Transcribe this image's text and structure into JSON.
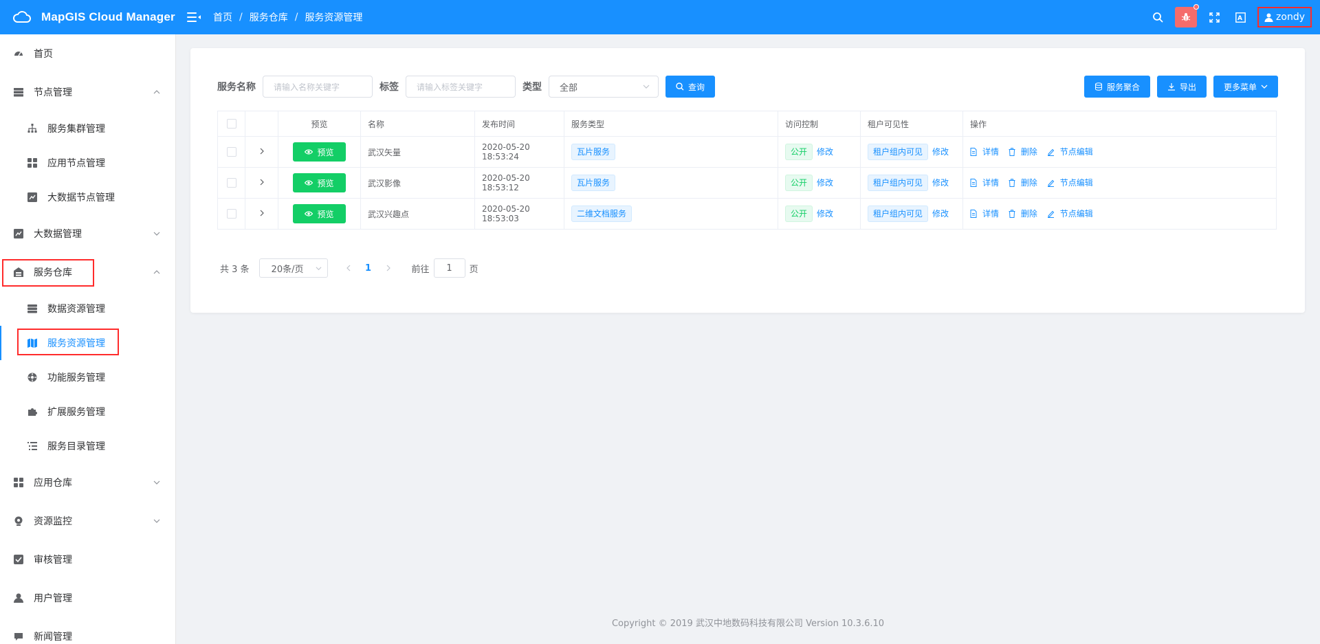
{
  "app": {
    "title": "MapGIS Cloud Manager"
  },
  "breadcrumb": [
    "首页",
    "服务仓库",
    "服务资源管理"
  ],
  "user": {
    "name": "zondy"
  },
  "colors": {
    "primary": "#1890ff",
    "success": "#13ce66",
    "danger": "#f56c6c",
    "highlight": "#ff2b2b"
  },
  "sidebar": {
    "items": [
      {
        "label": "首页",
        "icon": "dashboard-icon"
      },
      {
        "label": "节点管理",
        "icon": "server-icon",
        "expanded": true
      },
      {
        "label": "服务集群管理",
        "icon": "cluster-icon"
      },
      {
        "label": "应用节点管理",
        "icon": "grid-icon"
      },
      {
        "label": "大数据节点管理",
        "icon": "chart-icon"
      },
      {
        "label": "大数据管理",
        "icon": "chart-icon",
        "expanded": false
      },
      {
        "label": "服务仓库",
        "icon": "warehouse-icon",
        "expanded": true
      },
      {
        "label": "数据资源管理",
        "icon": "database-icon"
      },
      {
        "label": "服务资源管理",
        "icon": "map-icon",
        "active": true
      },
      {
        "label": "功能服务管理",
        "icon": "function-icon"
      },
      {
        "label": "扩展服务管理",
        "icon": "puzzle-icon"
      },
      {
        "label": "服务目录管理",
        "icon": "list-icon"
      },
      {
        "label": "应用仓库",
        "icon": "grid-icon",
        "expanded": false
      },
      {
        "label": "资源监控",
        "icon": "monitor-icon",
        "expanded": false
      },
      {
        "label": "审核管理",
        "icon": "check-icon"
      },
      {
        "label": "用户管理",
        "icon": "user-icon"
      },
      {
        "label": "新闻管理",
        "icon": "news-icon"
      }
    ]
  },
  "filters": {
    "name_label": "服务名称",
    "name_placeholder": "请输入名称关键字",
    "tag_label": "标签",
    "tag_placeholder": "请输入标签关键字",
    "type_label": "类型",
    "type_value": "全部",
    "search_label": "查询"
  },
  "actions": {
    "aggregate": "服务聚合",
    "export": "导出",
    "more": "更多菜单"
  },
  "table": {
    "columns": [
      "预览",
      "名称",
      "发布时间",
      "服务类型",
      "访问控制",
      "租户可见性",
      "操作"
    ],
    "preview_label": "预览",
    "edit_label": "修改",
    "ops": {
      "detail": "详情",
      "delete": "删除",
      "node_edit": "节点编辑"
    },
    "rows": [
      {
        "name": "武汉矢量",
        "time": "2020-05-20 18:53:24",
        "type": "瓦片服务",
        "access": "公开",
        "visibility": "租户组内可见"
      },
      {
        "name": "武汉影像",
        "time": "2020-05-20 18:53:12",
        "type": "瓦片服务",
        "access": "公开",
        "visibility": "租户组内可见"
      },
      {
        "name": "武汉兴趣点",
        "time": "2020-05-20 18:53:03",
        "type": "二维文档服务",
        "access": "公开",
        "visibility": "租户组内可见"
      }
    ]
  },
  "pagination": {
    "total": "共 3 条",
    "page_size": "20条/页",
    "current": "1",
    "goto_label": "前往",
    "goto_value": "1",
    "page_suffix": "页"
  },
  "footer": {
    "text": "Copyright © 2019 武汉中地数码科技有限公司 Version 10.3.6.10"
  }
}
